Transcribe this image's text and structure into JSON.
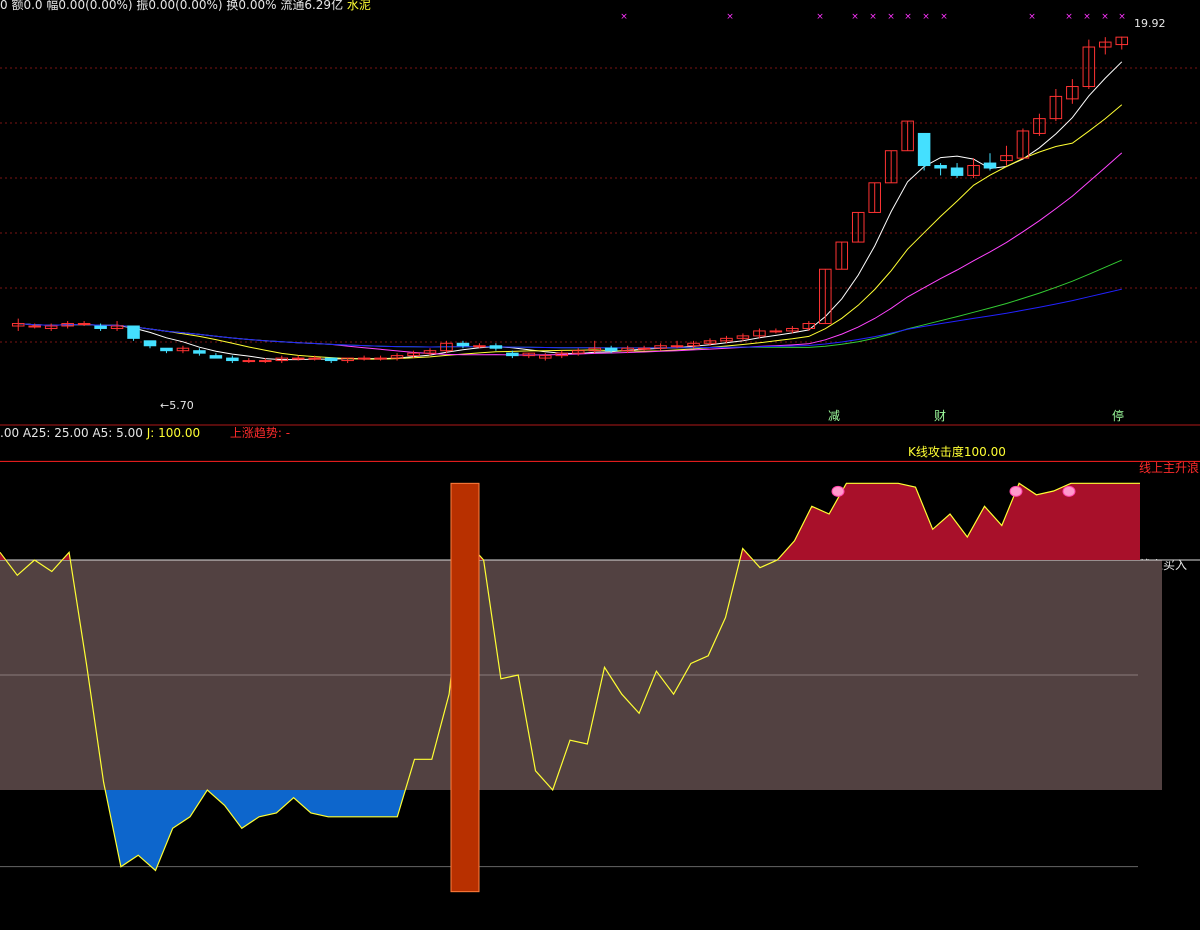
{
  "header": {
    "info_prefix": "0 额0.0 幅",
    "info_amp": "0.00(0.00%)",
    "info_amp_label": " 振",
    "info_swing": "0.00(0.00%)",
    "info_turnover": " 换0.00% 流通6.29亿",
    "info_sector": "水泥"
  },
  "price_panel": {
    "high_label": "19.92",
    "low_label": "5.70",
    "signals": [
      "减",
      "财",
      "停"
    ]
  },
  "indicator_header": {
    "a_label": ".00",
    "a25": "A25: 25.00",
    "a5": "A5: 5.00",
    "j": "J: 100.00",
    "trend": "上涨趋势: -"
  },
  "annotations": {
    "k_attack": "K线攻击度100.00",
    "main_wave": "线上主升浪",
    "buy_line": "线上买入",
    "purple_mark": "买"
  },
  "colors": {
    "up": "#ff3333",
    "down": "#44e0ff",
    "ma5": "#ffffff",
    "ma10": "#ffff33",
    "ma20": "#ff44ff",
    "ma60": "#33cc33",
    "ma120": "#2222ff",
    "red_fill": "#a8102a",
    "blue_fill": "#0d66cc",
    "band": "#524141",
    "line": "#ffff33"
  },
  "chart_data": [
    {
      "type": "candlestick",
      "title": "",
      "ylim": [
        5,
        21
      ],
      "candles": [
        [
          8.2,
          8.3,
          8.0,
          8.5
        ],
        [
          8.2,
          8.2,
          8.1,
          8.3
        ],
        [
          8.1,
          8.2,
          8.0,
          8.3
        ],
        [
          8.2,
          8.3,
          8.1,
          8.4
        ],
        [
          8.3,
          8.3,
          8.2,
          8.4
        ],
        [
          8.2,
          8.1,
          8.0,
          8.3
        ],
        [
          8.1,
          8.2,
          8.0,
          8.4
        ],
        [
          8.2,
          7.7,
          7.6,
          8.2
        ],
        [
          7.6,
          7.4,
          7.3,
          7.6
        ],
        [
          7.3,
          7.2,
          7.1,
          7.3
        ],
        [
          7.2,
          7.3,
          7.1,
          7.4
        ],
        [
          7.2,
          7.1,
          7.0,
          7.3
        ],
        [
          7.0,
          6.9,
          6.9,
          7.1
        ],
        [
          6.9,
          6.8,
          6.7,
          7.0
        ],
        [
          6.8,
          6.8,
          6.7,
          6.9
        ],
        [
          6.8,
          6.8,
          6.7,
          6.9
        ],
        [
          6.8,
          6.9,
          6.7,
          7.0
        ],
        [
          6.9,
          6.9,
          6.8,
          7.0
        ],
        [
          6.9,
          6.9,
          6.8,
          7.0
        ],
        [
          6.9,
          6.8,
          6.7,
          6.9
        ],
        [
          6.8,
          6.9,
          6.7,
          6.9
        ],
        [
          6.9,
          6.9,
          6.8,
          7.0
        ],
        [
          6.9,
          6.9,
          6.8,
          7.0
        ],
        [
          6.9,
          7.0,
          6.8,
          7.1
        ],
        [
          7.0,
          7.1,
          6.9,
          7.2
        ],
        [
          7.1,
          7.2,
          7.0,
          7.3
        ],
        [
          7.2,
          7.5,
          7.1,
          7.6
        ],
        [
          7.5,
          7.4,
          7.3,
          7.6
        ],
        [
          7.4,
          7.4,
          7.3,
          7.5
        ],
        [
          7.4,
          7.3,
          7.2,
          7.5
        ],
        [
          7.1,
          7.0,
          6.9,
          7.2
        ],
        [
          7.0,
          7.1,
          6.9,
          7.1
        ],
        [
          6.9,
          7.0,
          6.8,
          7.1
        ],
        [
          7.0,
          7.1,
          6.9,
          7.2
        ],
        [
          7.1,
          7.2,
          7.0,
          7.3
        ],
        [
          7.2,
          7.3,
          7.1,
          7.6
        ],
        [
          7.3,
          7.2,
          7.1,
          7.4
        ],
        [
          7.2,
          7.3,
          7.1,
          7.4
        ],
        [
          7.3,
          7.3,
          7.2,
          7.4
        ],
        [
          7.3,
          7.4,
          7.2,
          7.5
        ],
        [
          7.4,
          7.4,
          7.3,
          7.6
        ],
        [
          7.4,
          7.5,
          7.3,
          7.6
        ],
        [
          7.5,
          7.6,
          7.4,
          7.7
        ],
        [
          7.6,
          7.7,
          7.5,
          7.8
        ],
        [
          7.7,
          7.8,
          7.6,
          7.9
        ],
        [
          7.8,
          8.0,
          7.7,
          8.1
        ],
        [
          8.0,
          8.0,
          7.9,
          8.1
        ],
        [
          8.0,
          8.1,
          7.9,
          8.2
        ],
        [
          8.1,
          8.3,
          8.0,
          8.4
        ],
        [
          8.3,
          10.5,
          8.3,
          10.5
        ],
        [
          10.5,
          11.6,
          10.5,
          11.6
        ],
        [
          11.6,
          12.8,
          11.6,
          12.8
        ],
        [
          12.8,
          14.0,
          12.8,
          14.0
        ],
        [
          14.0,
          15.3,
          14.0,
          15.3
        ],
        [
          15.3,
          16.5,
          15.3,
          16.5
        ],
        [
          16.0,
          14.7,
          14.5,
          16.0
        ],
        [
          14.7,
          14.6,
          14.3,
          14.8
        ],
        [
          14.6,
          14.3,
          14.2,
          14.8
        ],
        [
          14.3,
          14.7,
          14.2,
          15.0
        ],
        [
          14.8,
          14.6,
          14.5,
          15.2
        ],
        [
          14.9,
          15.1,
          14.7,
          15.5
        ],
        [
          15.0,
          16.1,
          15.0,
          16.2
        ],
        [
          16.0,
          16.6,
          15.9,
          16.8
        ],
        [
          16.6,
          17.5,
          16.5,
          17.8
        ],
        [
          17.4,
          17.9,
          17.2,
          18.2
        ],
        [
          17.9,
          19.5,
          17.8,
          19.8
        ],
        [
          19.5,
          19.7,
          19.2,
          19.9
        ],
        [
          19.6,
          19.9,
          19.4,
          19.92
        ]
      ]
    },
    {
      "type": "area",
      "title": "",
      "ylim": [
        -10,
        110
      ],
      "reference_lines": [
        100,
        80,
        50,
        20,
        0
      ],
      "values": [
        82,
        76,
        80,
        77,
        82,
        53,
        22,
        0,
        3,
        -1,
        10,
        13,
        20,
        16,
        10,
        13,
        14,
        18,
        14,
        13,
        13,
        13,
        13,
        13,
        28,
        28,
        45,
        85,
        80,
        49,
        50,
        25,
        20,
        33,
        32,
        52,
        45,
        40,
        51,
        45,
        53,
        55,
        65,
        83,
        78,
        80,
        85,
        94,
        92,
        100,
        100,
        100,
        100,
        99,
        88,
        92,
        86,
        94,
        89,
        100,
        97,
        98,
        100,
        100,
        100,
        100,
        100
      ],
      "highlight_bar": {
        "label": "",
        "from": 0,
        "to": 100
      }
    }
  ]
}
